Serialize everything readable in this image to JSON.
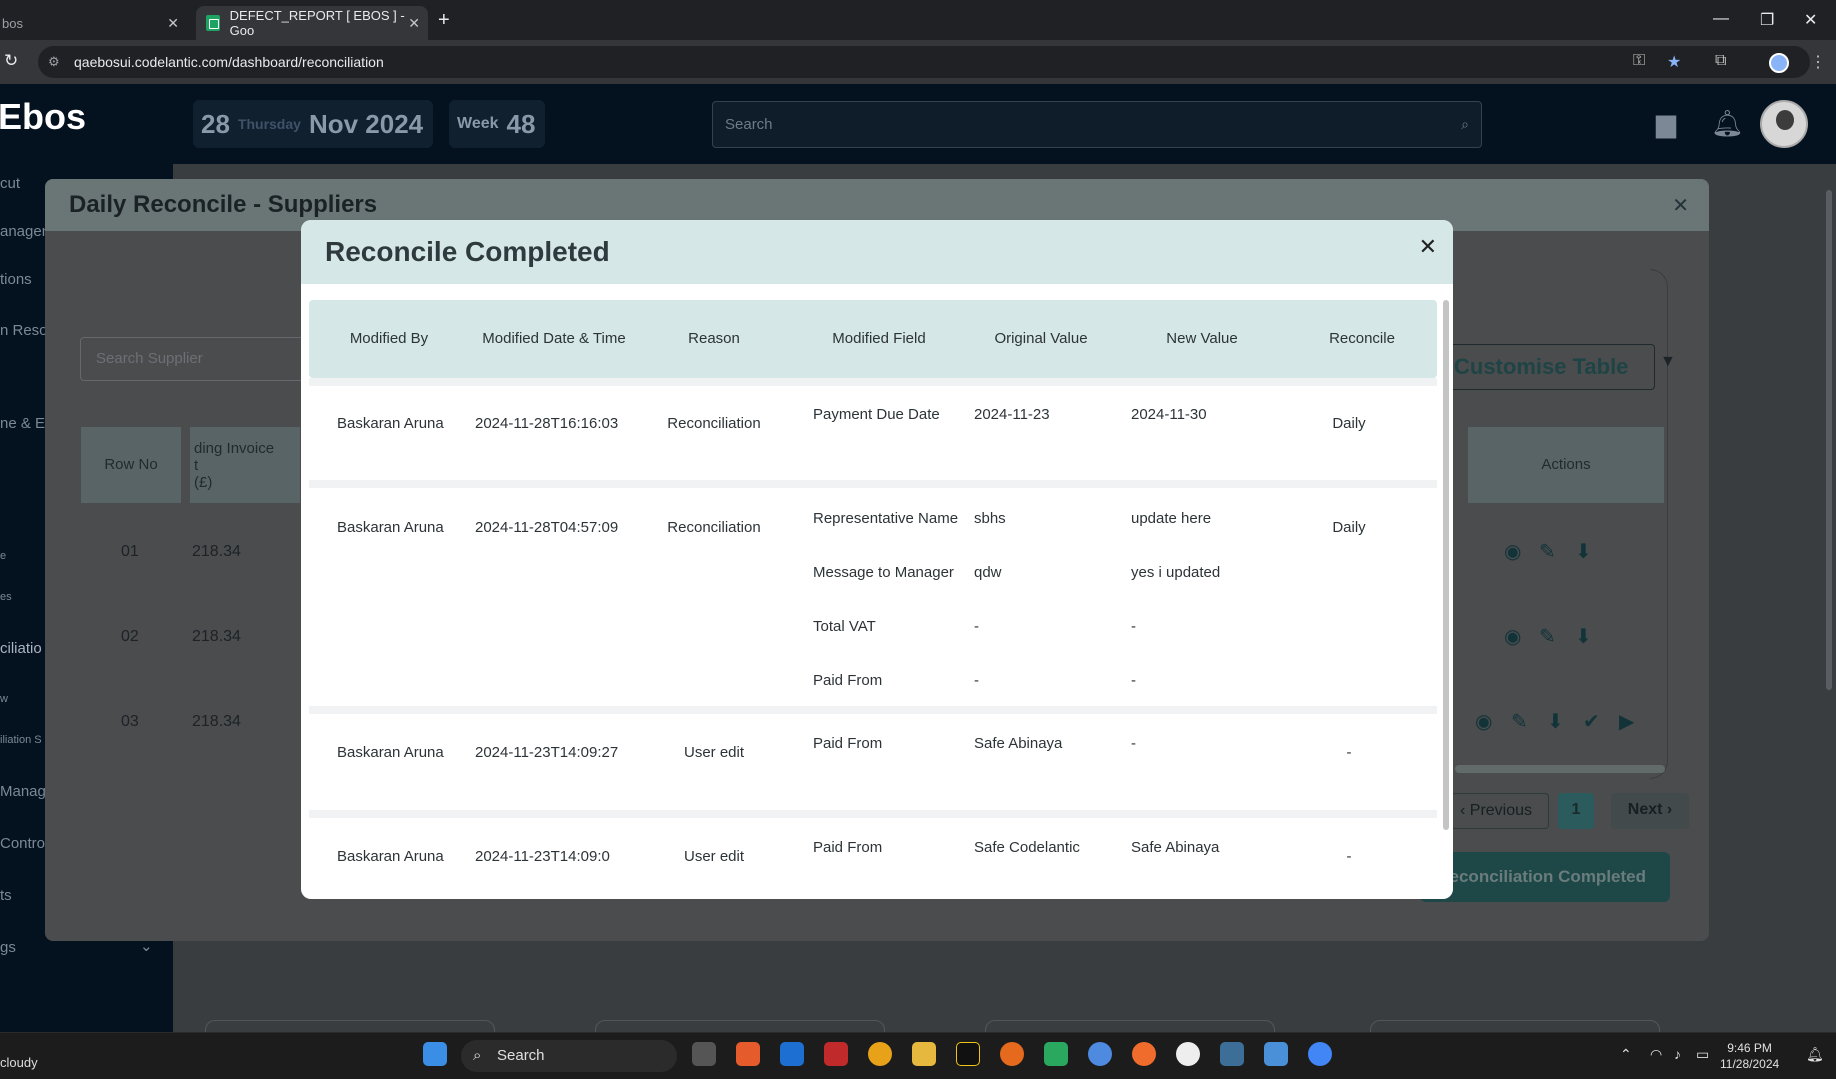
{
  "browser": {
    "tabs": [
      {
        "label": "bos"
      },
      {
        "label": "DEFECT_REPORT [ EBOS ] - Goo"
      }
    ],
    "url": "qaebosui.codelantic.com/dashboard/reconciliation"
  },
  "app": {
    "logo": "Ebos",
    "date": {
      "day": "28",
      "weekday": "Thursday",
      "month_year": "Nov 2024"
    },
    "week": {
      "label": "Week",
      "number": "48"
    },
    "search_placeholder": "Search"
  },
  "sidebar": {
    "items": [
      {
        "label": "cut"
      },
      {
        "label": "anagem"
      },
      {
        "label": "tions"
      },
      {
        "label": "n Reso"
      },
      {
        "label": "ne & Ex"
      },
      {
        "label": "e"
      },
      {
        "label": "es"
      },
      {
        "label": "ciliatio"
      },
      {
        "label": "w"
      },
      {
        "label": "iliation S"
      },
      {
        "label": "Manag"
      },
      {
        "label": "Control"
      },
      {
        "label": "ts"
      },
      {
        "label": "gs"
      }
    ]
  },
  "panel": {
    "title": "Daily Reconcile - Suppliers",
    "search_placeholder": "Search Supplier",
    "customise_label": "Customise Table",
    "headers": {
      "row_no": "Row No",
      "invoice": "ding Invoice",
      "invoice_l2": "t",
      "invoice_l3": "(£)",
      "actions": "Actions"
    },
    "rows": [
      {
        "no": "01",
        "amount": "218.34"
      },
      {
        "no": "02",
        "amount": "218.34"
      },
      {
        "no": "03",
        "amount": "218.34"
      }
    ],
    "pagination": {
      "previous": "Previous",
      "page": "1",
      "next": "Next"
    },
    "completed_label": "Reconciliation Completed"
  },
  "modal": {
    "title": "Reconcile Completed",
    "columns": [
      "Modified By",
      "Modified Date & Time",
      "Reason",
      "Modified Field",
      "Original Value",
      "New Value",
      "Reconcile"
    ],
    "rows": [
      {
        "by": "Baskaran Aruna",
        "datetime": "2024-11-28T16:16:03",
        "reason": "Reconciliation",
        "reconcile": "Daily",
        "changes": [
          {
            "field": "Payment Due Date",
            "original": "2024-11-23",
            "new": "2024-11-30"
          }
        ]
      },
      {
        "by": "Baskaran Aruna",
        "datetime": "2024-11-28T04:57:09",
        "reason": "Reconciliation",
        "reconcile": "Daily",
        "changes": [
          {
            "field": "Representative Name",
            "original": "sbhs",
            "new": "update here"
          },
          {
            "field": "Message to Manager",
            "original": "qdw",
            "new": "yes i updated"
          },
          {
            "field": "Total VAT",
            "original": "-",
            "new": "-"
          },
          {
            "field": "Paid From",
            "original": "-",
            "new": "-"
          }
        ]
      },
      {
        "by": "Baskaran Aruna",
        "datetime": "2024-11-23T14:09:27",
        "reason": "User edit",
        "reconcile": "-",
        "changes": [
          {
            "field": "Paid From",
            "original": "Safe Abinaya",
            "new": "-"
          }
        ]
      },
      {
        "by": "Baskaran Aruna",
        "datetime": "2024-11-23T14:09:0",
        "reason": "User edit",
        "reconcile": "-",
        "changes": [
          {
            "field": "Paid From",
            "original": "Safe Codelantic",
            "new": "Safe Abinaya"
          }
        ]
      }
    ]
  },
  "taskbar": {
    "search_label": "Search",
    "time": "9:46 PM",
    "date": "11/28/2024",
    "weather": "cloudy"
  }
}
